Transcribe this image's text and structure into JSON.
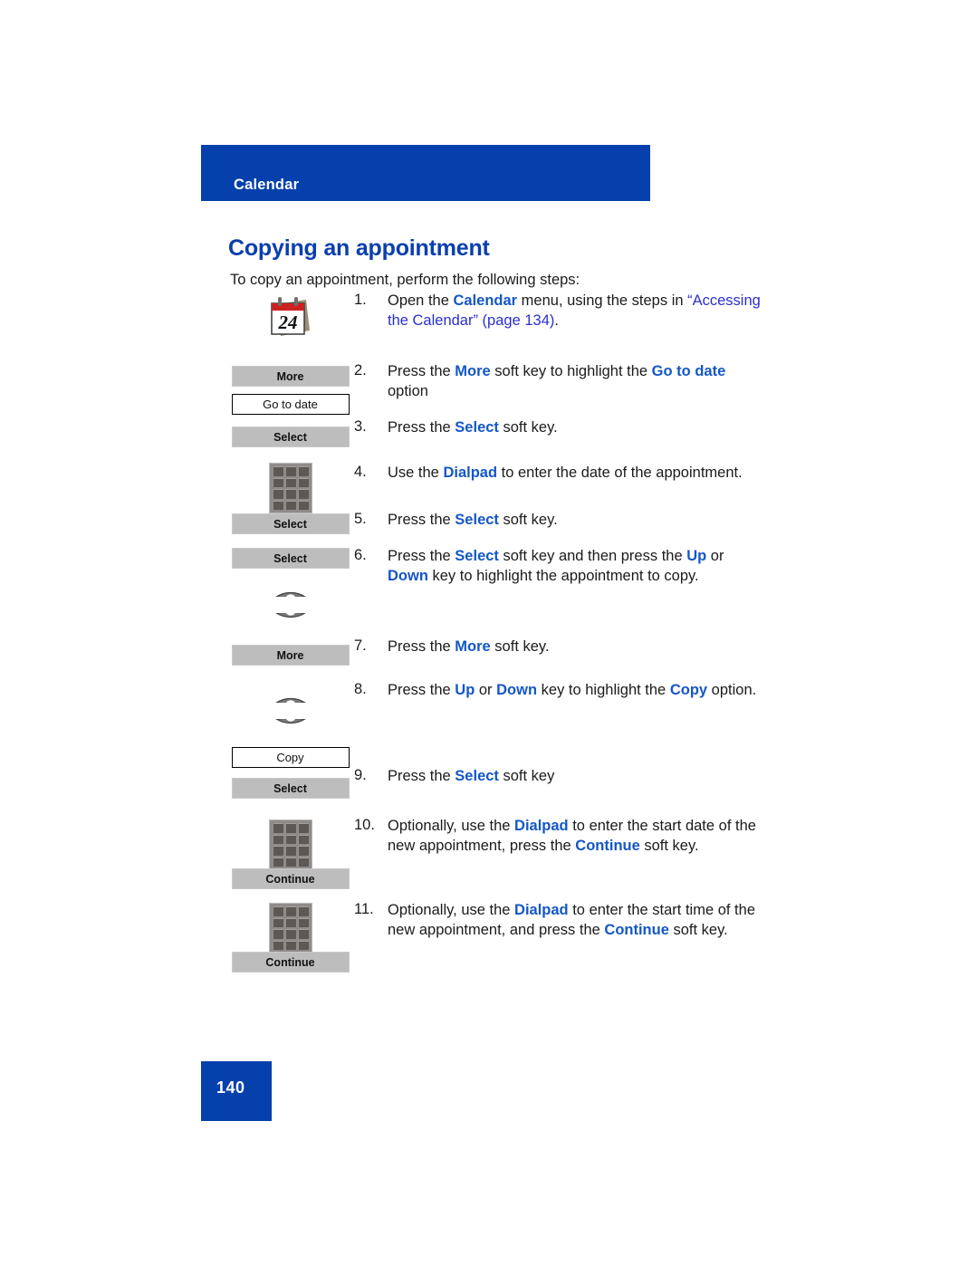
{
  "header": {
    "running_head": "Calendar"
  },
  "title": "Copying an appointment",
  "intro": "To copy an appointment, perform the following steps:",
  "footer": {
    "page_number": "140"
  },
  "colors": {
    "brand_blue": "#0540AC",
    "heading_blue": "#0A3FAE",
    "term_blue": "#1457C6",
    "xref_blue": "#2A2FCF",
    "softkey_gray": "#BDBDBD"
  },
  "steps": [
    {
      "number": "1.",
      "icons": [
        "calendar-icon"
      ],
      "text_parts": [
        {
          "t": "Open the ",
          "s": "plain"
        },
        {
          "t": "Calendar",
          "s": "term"
        },
        {
          "t": " menu, using the steps in ",
          "s": "plain"
        },
        {
          "t": "“Accessing the Calendar” (page 134)",
          "s": "xref"
        },
        {
          "t": ".",
          "s": "plain"
        }
      ]
    },
    {
      "number": "2.",
      "icons": [
        "softkey-more",
        "menuitem-go-to-date"
      ],
      "softkey_labels": [
        "More"
      ],
      "menuitem_labels": [
        "Go to date"
      ],
      "text_parts": [
        {
          "t": "Press the ",
          "s": "plain"
        },
        {
          "t": "More",
          "s": "term"
        },
        {
          "t": " soft key to highlight the ",
          "s": "plain"
        },
        {
          "t": "Go to date",
          "s": "term"
        },
        {
          "t": " option",
          "s": "plain"
        }
      ]
    },
    {
      "number": "3.",
      "icons": [
        "softkey-select"
      ],
      "softkey_labels": [
        "Select"
      ],
      "text_parts": [
        {
          "t": "Press the ",
          "s": "plain"
        },
        {
          "t": "Select",
          "s": "term"
        },
        {
          "t": " soft key.",
          "s": "plain"
        }
      ]
    },
    {
      "number": "4.",
      "icons": [
        "dialpad-icon"
      ],
      "text_parts": [
        {
          "t": "Use the ",
          "s": "plain"
        },
        {
          "t": "Dialpad",
          "s": "term"
        },
        {
          "t": " to enter the date of the appointment.",
          "s": "plain"
        }
      ]
    },
    {
      "number": "5.",
      "icons": [
        "softkey-select"
      ],
      "softkey_labels": [
        "Select"
      ],
      "text_parts": [
        {
          "t": "Press the ",
          "s": "plain"
        },
        {
          "t": "Select",
          "s": "term"
        },
        {
          "t": " soft key.",
          "s": "plain"
        }
      ]
    },
    {
      "number": "6.",
      "icons": [
        "softkey-select",
        "nav-up-icon",
        "nav-down-icon"
      ],
      "softkey_labels": [
        "Select"
      ],
      "text_parts": [
        {
          "t": "Press the ",
          "s": "plain"
        },
        {
          "t": "Select",
          "s": "term"
        },
        {
          "t": " soft key and then press the ",
          "s": "plain"
        },
        {
          "t": "Up",
          "s": "term"
        },
        {
          "t": " or ",
          "s": "plain"
        },
        {
          "t": "Down",
          "s": "term"
        },
        {
          "t": " key to highlight the appointment to copy.",
          "s": "plain"
        }
      ]
    },
    {
      "number": "7.",
      "icons": [
        "softkey-more"
      ],
      "softkey_labels": [
        "More"
      ],
      "text_parts": [
        {
          "t": "Press the ",
          "s": "plain"
        },
        {
          "t": "More",
          "s": "term"
        },
        {
          "t": " soft key.",
          "s": "plain"
        }
      ]
    },
    {
      "number": "8.",
      "icons": [
        "nav-up-icon",
        "nav-down-icon",
        "menuitem-copy"
      ],
      "menuitem_labels": [
        "Copy"
      ],
      "text_parts": [
        {
          "t": "Press the ",
          "s": "plain"
        },
        {
          "t": "Up",
          "s": "term"
        },
        {
          "t": " or ",
          "s": "plain"
        },
        {
          "t": "Down",
          "s": "term"
        },
        {
          "t": " key to highlight the ",
          "s": "plain"
        },
        {
          "t": "Copy",
          "s": "term"
        },
        {
          "t": " option.",
          "s": "plain"
        }
      ]
    },
    {
      "number": "9.",
      "icons": [
        "softkey-select"
      ],
      "softkey_labels": [
        "Select"
      ],
      "text_parts": [
        {
          "t": "Press the ",
          "s": "plain"
        },
        {
          "t": "Select",
          "s": "term"
        },
        {
          "t": " soft key",
          "s": "plain"
        }
      ]
    },
    {
      "number": "10.",
      "icons": [
        "dialpad-icon",
        "softkey-continue"
      ],
      "softkey_labels": [
        "Continue"
      ],
      "text_parts": [
        {
          "t": "Optionally, use the ",
          "s": "plain"
        },
        {
          "t": "Dialpad",
          "s": "term"
        },
        {
          "t": " to enter the start date of the new appointment, press the ",
          "s": "plain"
        },
        {
          "t": "Continue",
          "s": "term"
        },
        {
          "t": " soft key.",
          "s": "plain"
        }
      ]
    },
    {
      "number": "11.",
      "icons": [
        "dialpad-icon",
        "softkey-continue"
      ],
      "softkey_labels": [
        "Continue"
      ],
      "text_parts": [
        {
          "t": "Optionally, use the ",
          "s": "plain"
        },
        {
          "t": "Dialpad",
          "s": "term"
        },
        {
          "t": " to enter the start time of the new appointment, and press the ",
          "s": "plain"
        },
        {
          "t": "Continue",
          "s": "term"
        },
        {
          "t": " soft key.",
          "s": "plain"
        }
      ]
    }
  ],
  "calendar_icon": {
    "day_number": "24",
    "band_color": "#CC2222"
  }
}
